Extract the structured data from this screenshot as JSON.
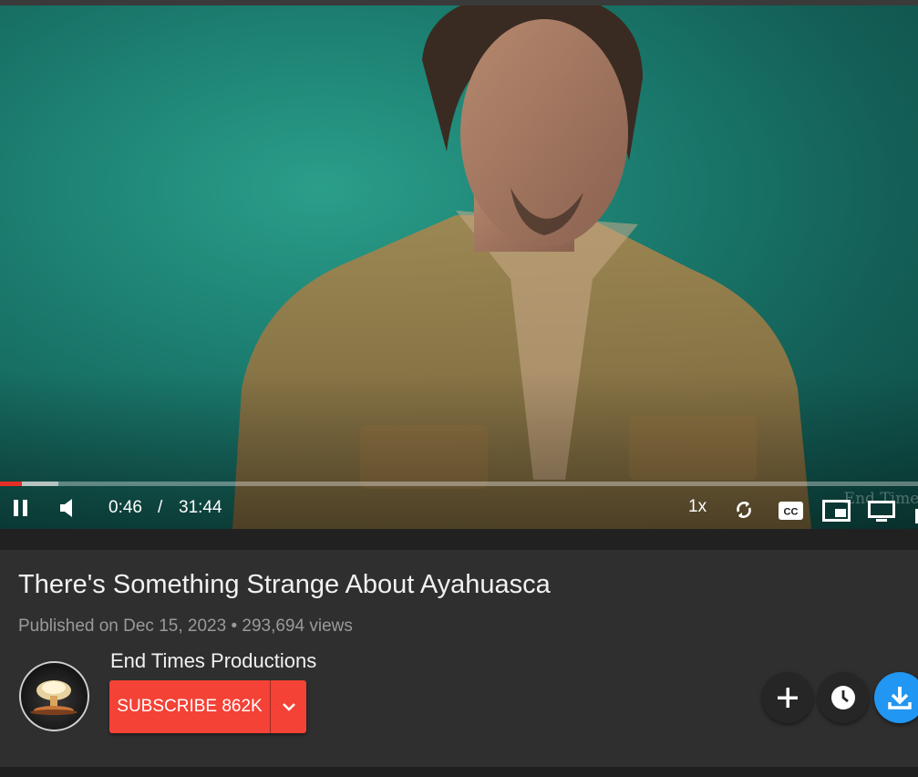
{
  "player": {
    "current_time": "0:46",
    "separator": "/",
    "duration": "31:44",
    "playback_rate": "1x",
    "progress_fraction": 0.024,
    "buffered_fraction": 0.064,
    "watermark_text": "End Times",
    "controls": {
      "left": [
        "pause-icon",
        "volume-icon"
      ],
      "right": [
        "loop-icon",
        "cc-icon",
        "picture-in-picture-icon",
        "cast-tv-icon"
      ]
    }
  },
  "video": {
    "title": "There's Something Strange About Ayahuasca",
    "published_date": "Published on Dec 15, 2023",
    "meta_separator": "•",
    "views": "293,694 views"
  },
  "channel": {
    "name": "End Times Productions",
    "avatar_icon": "mushroom-cloud-logo",
    "subscribe_label": "SUBSCRIBE 862K"
  },
  "actions": [
    "add-icon",
    "clock-icon",
    "download-icon"
  ],
  "colors": {
    "accent_red": "#f44236",
    "progress_red": "#e52d27",
    "download_blue": "#2196f3",
    "background": "#2f2f2f"
  }
}
